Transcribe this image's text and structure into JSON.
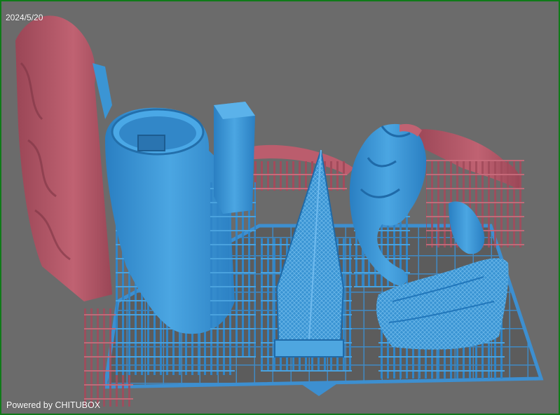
{
  "overlay": {
    "date": "2024/5/20",
    "credit": "Powered by CHITUBOX"
  },
  "colors": {
    "frame": "#0f7a18",
    "background": "#6b6b6b",
    "model_selected": "#3b95d4",
    "model_unselected": "#b85c6c",
    "plate": "#3d8fd0"
  },
  "scene": {
    "models": [
      {
        "name": "left-rock-wall",
        "state": "unselected"
      },
      {
        "name": "tall-cylinder-tower",
        "state": "selected"
      },
      {
        "name": "square-pillar",
        "state": "selected"
      },
      {
        "name": "curved-arch",
        "state": "unselected"
      },
      {
        "name": "pyramid-spire",
        "state": "selected"
      },
      {
        "name": "muscular-figure",
        "state": "selected"
      },
      {
        "name": "figure-arm-right",
        "state": "unselected"
      },
      {
        "name": "cloth-base",
        "state": "selected"
      }
    ]
  }
}
